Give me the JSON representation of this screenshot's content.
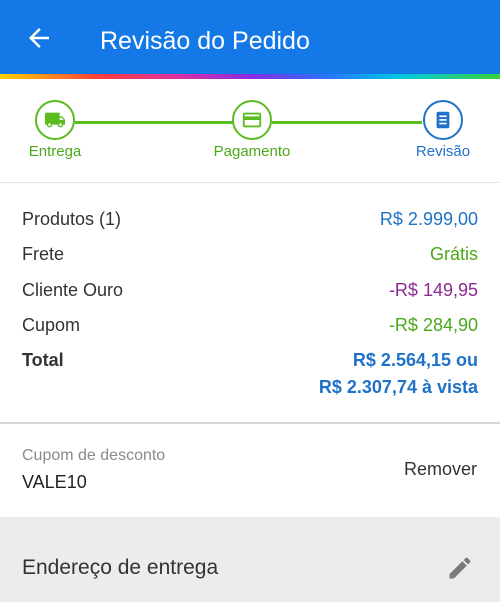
{
  "header": {
    "title": "Revisão do Pedido",
    "back_icon": "arrow-left-icon"
  },
  "colors": {
    "appbar": "#1478e6",
    "step_done": "#5bbb1f",
    "step_current": "#1f72c8",
    "price_blue": "#1f72c8",
    "price_green": "#4aa81a",
    "price_purple": "#8b2b8f"
  },
  "steps": [
    {
      "label": "Entrega",
      "icon": "truck-icon",
      "state": "done"
    },
    {
      "label": "Pagamento",
      "icon": "credit-card-icon",
      "state": "done"
    },
    {
      "label": "Revisão",
      "icon": "list-icon",
      "state": "current"
    }
  ],
  "summary": {
    "products": {
      "label": "Produtos (1)",
      "value": "R$ 2.999,00"
    },
    "shipping": {
      "label": "Frete",
      "value": "Grátis"
    },
    "gold": {
      "label": "Cliente Ouro",
      "value": "-R$ 149,95"
    },
    "coupon": {
      "label": "Cupom",
      "value": "-R$ 284,90"
    },
    "total": {
      "label": "Total",
      "value_line1": "R$ 2.564,15 ou",
      "value_line2": "R$ 2.307,74 à vista"
    }
  },
  "coupon": {
    "label": "Cupom de desconto",
    "code": "VALE10",
    "remove_label": "Remover"
  },
  "address": {
    "title": "Endereço de entrega",
    "edit_icon": "pencil-icon"
  }
}
